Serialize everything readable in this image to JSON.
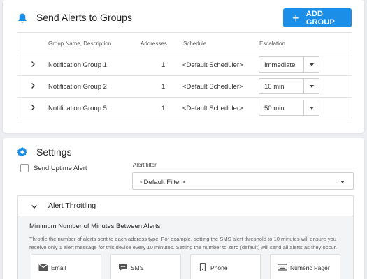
{
  "groups_section": {
    "title": "Send Alerts to Groups",
    "add_button": "ADD GROUP",
    "columns": [
      "Group Name, Description",
      "Addresses",
      "Schedule",
      "Escalation"
    ],
    "rows": [
      {
        "name": "Notification Group 1",
        "addresses": "1",
        "schedule": "<Default Scheduler>",
        "escalation": "Immediate"
      },
      {
        "name": "Notification Group 2",
        "addresses": "1",
        "schedule": "<Default Scheduler>",
        "escalation": "10 min"
      },
      {
        "name": "Notification Group 5",
        "addresses": "1",
        "schedule": "<Default Scheduler>",
        "escalation": "50 min"
      }
    ]
  },
  "settings_section": {
    "title": "Settings",
    "send_uptime_label": "Send Uptime Alert",
    "send_uptime_checked": false,
    "alert_filter_label": "Alert filter",
    "alert_filter_value": "<Default Filter>",
    "throttling": {
      "title": "Alert Throttling",
      "heading": "Minimum Number of Minutes Between Alerts:",
      "description": "Throttle the number of alerts sent to each address type. For example, setting the SMS alert threshold to 10 minutes will ensure you receive only 1 alert message for this device every 10 minutes. Setting the number to zero (default) will send all alerts as they occur.",
      "types": [
        {
          "label": "Email",
          "icon": "envelope-icon"
        },
        {
          "label": "SMS",
          "icon": "sms-chat-icon"
        },
        {
          "label": "Phone",
          "icon": "mobile-phone-icon"
        },
        {
          "label": "Numeric Pager",
          "icon": "pager-keyboard-icon"
        }
      ]
    }
  },
  "colors": {
    "accent": "#1b8ee8",
    "background": "#eceef1"
  }
}
